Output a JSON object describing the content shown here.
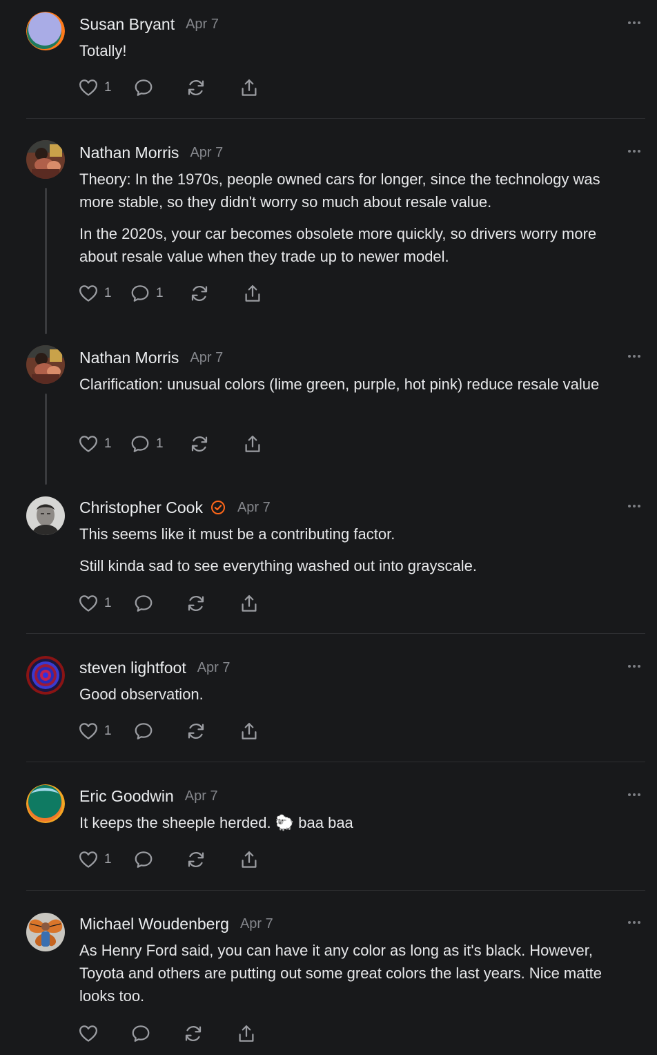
{
  "posts": [
    {
      "author": "Susan Bryant",
      "date": "Apr 7",
      "paragraphs": [
        "Totally!"
      ],
      "likes": "1",
      "replies": "",
      "avatar": "tricolor-circle-lavender"
    },
    {
      "author": "Nathan Morris",
      "date": "Apr 7",
      "paragraphs": [
        "Theory: In the 1970s, people owned cars for longer, since the technology was more stable, so they didn't worry so much about resale value.",
        "In the 2020s, your car becomes obsolete more quickly, so drivers worry more about resale value when they trade up to newer model."
      ],
      "likes": "1",
      "replies": "1",
      "avatar": "photo"
    },
    {
      "author": "Nathan Morris",
      "date": "Apr 7",
      "paragraphs": [
        "Clarification: unusual colors (lime green, purple, hot pink) reduce resale value"
      ],
      "likes": "1",
      "replies": "1",
      "avatar": "photo"
    },
    {
      "author": "Christopher Cook",
      "date": "Apr 7",
      "verified": true,
      "paragraphs": [
        "This seems like it must be a contributing factor.",
        "Still kinda sad to see everything washed out into grayscale."
      ],
      "likes": "1",
      "replies": "",
      "avatar": "photo"
    },
    {
      "author": "steven lightfoot",
      "date": "Apr 7",
      "paragraphs": [
        "Good observation."
      ],
      "likes": "1",
      "replies": "",
      "avatar": "concentric-circles"
    },
    {
      "author": "Eric Goodwin",
      "date": "Apr 7",
      "paragraphs": [
        "It keeps the sheeple herded. 🐑 baa baa"
      ],
      "likes": "1",
      "replies": "",
      "avatar": "tricolor-circle-green"
    },
    {
      "author": "Michael Woudenberg",
      "date": "Apr 7",
      "paragraphs": [
        "As Henry Ford said, you can have it any color as long as it's black. However, Toyota and others are putting out some great colors the last years. Nice matte looks too."
      ],
      "likes": "",
      "replies": "",
      "avatar": "photo-butterfly"
    }
  ],
  "icons": {
    "like": "heart-icon",
    "reply": "comment-icon",
    "restack": "restack-icon",
    "share": "share-icon",
    "more": "more-icon",
    "verified": "verified-check-icon"
  },
  "colors": {
    "background": "#18191b",
    "text": "#e7e8ea",
    "muted": "#85878c",
    "icon": "#9b9da2",
    "verified": "#ff6719",
    "divider": "#2e2f32"
  }
}
